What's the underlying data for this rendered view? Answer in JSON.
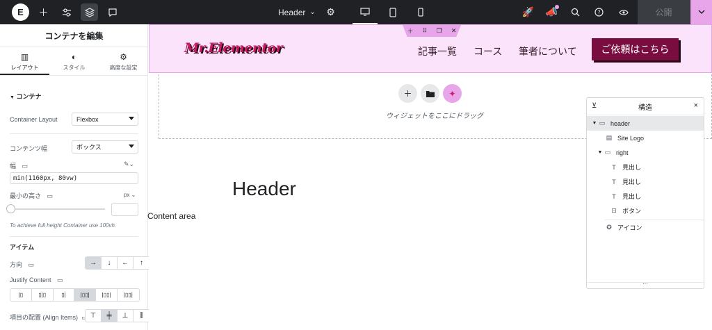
{
  "topbar": {
    "logo": "E",
    "document_title": "Header",
    "publish_label": "公開"
  },
  "panel": {
    "title": "コンテナを編集",
    "tabs": [
      {
        "label": "レイアウト",
        "icon": "layout-icon"
      },
      {
        "label": "スタイル",
        "icon": "style-icon"
      },
      {
        "label": "高度な設定",
        "icon": "gear-icon"
      }
    ],
    "section_container": "コンテナ",
    "container_layout_label": "Container Layout",
    "container_layout_value": "Flexbox",
    "content_width_label": "コンテンツ幅",
    "content_width_value": "ボックス",
    "width_label": "幅",
    "width_value": "min(1160px, 80vw)",
    "min_height_label": "最小の高さ",
    "min_height_unit": "px",
    "hint": "To achieve full height Container use 100vh.",
    "section_items": "アイテム",
    "direction_label": "方向",
    "direction_options": [
      "→",
      "↓",
      "←",
      "↑"
    ],
    "justify_label": "Justify Content",
    "align_label": "項目の配置 (Align Items)"
  },
  "canvas": {
    "site_logo": "Mr.Elementor",
    "nav": [
      "記事一覧",
      "コース",
      "筆者について"
    ],
    "cta": "ご依頼はこちら",
    "drop_hint": "ウィジェットをここにドラッグ",
    "title": "Header",
    "content_area": "Content area"
  },
  "structure": {
    "title": "構造",
    "items": [
      {
        "label": "header",
        "icon": "container-icon"
      },
      {
        "label": "Site Logo",
        "icon": "site-logo-icon"
      },
      {
        "label": "right",
        "icon": "container-icon"
      },
      {
        "label": "見出し",
        "icon": "heading-icon"
      },
      {
        "label": "見出し",
        "icon": "heading-icon"
      },
      {
        "label": "見出し",
        "icon": "heading-icon"
      },
      {
        "label": "ボタン",
        "icon": "button-icon"
      },
      {
        "label": "アイコン",
        "icon": "icon-widget-icon"
      }
    ]
  },
  "colors": {
    "accent_pink": "#e8a5e9",
    "header_bg": "#fbe4fb",
    "cta_bg": "#7a0d3f",
    "topbar_bg": "#1f2124"
  }
}
